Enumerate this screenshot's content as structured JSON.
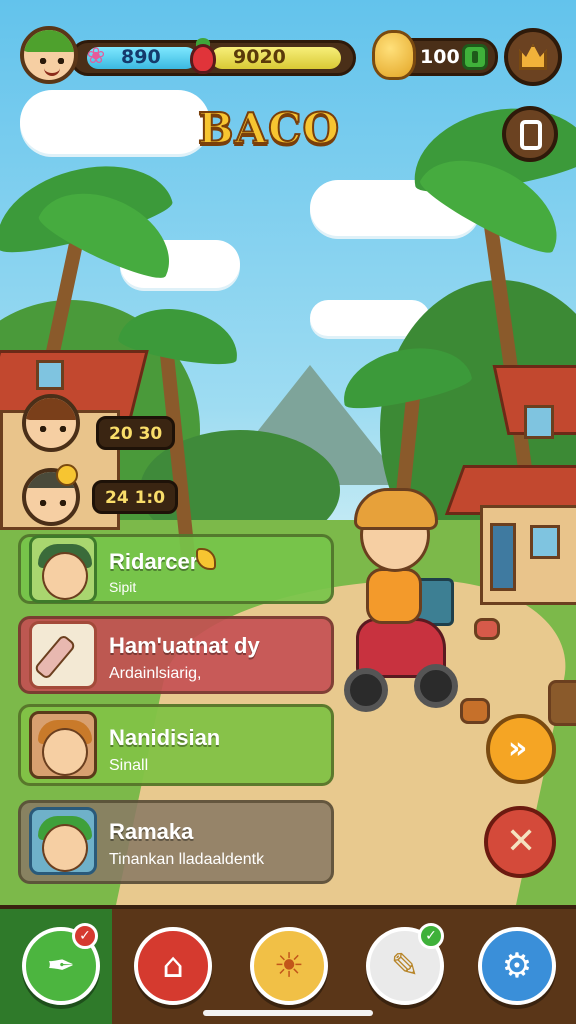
{
  "title": "BACO",
  "hud": {
    "gems": "890",
    "fruit": "9020",
    "gold": "100"
  },
  "side_stats": [
    {
      "label": "20 30"
    },
    {
      "label": "24 1:0"
    }
  ],
  "quests": [
    {
      "title": "Ridarcer",
      "subtitle": "Sipit"
    },
    {
      "title": "Ham'uatnat dy",
      "subtitle": "Ardainlsiarig,"
    },
    {
      "title": "Nanidisian",
      "subtitle": "Sinall"
    },
    {
      "title": "Ramaka",
      "subtitle": "Tinankan lladaaldentk"
    }
  ],
  "icons": {
    "gem": "❀",
    "nav_chat": "✒",
    "nav_home": "⌂",
    "nav_sun": "☀",
    "nav_tool": "✎",
    "nav_settings": "⚙",
    "arrow": "»",
    "cancel": "✕",
    "check": "✓"
  },
  "colors": {
    "title": "#f7c531",
    "quest_green": "#76c44a",
    "quest_red": "#c44e52",
    "quest_gray": "#8a7a64",
    "bottom_bar": "#5a3618"
  }
}
